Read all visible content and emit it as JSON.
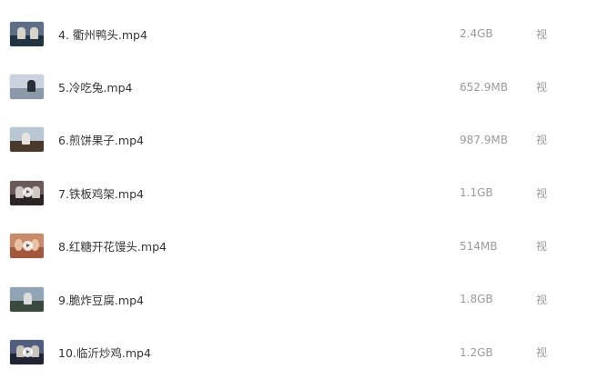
{
  "files": [
    {
      "name": "4. 衢州鸭头.mp4",
      "size": "2.4GB",
      "type": "视",
      "thumb_icon": "video-thumbnail",
      "thumb_colors": [
        "#5d6f86",
        "#223344",
        "#d9d2c8"
      ],
      "play_overlay": false
    },
    {
      "name": "5.冷吃兔.mp4",
      "size": "652.9MB",
      "type": "视",
      "thumb_icon": "video-thumbnail",
      "thumb_colors": [
        "#c9d2de",
        "#8a98aa",
        "#2a2f36"
      ],
      "play_overlay": false
    },
    {
      "name": "6.煎饼果子.mp4",
      "size": "987.9MB",
      "type": "视",
      "thumb_icon": "video-thumbnail",
      "thumb_colors": [
        "#b9c6d3",
        "#4a3a2c",
        "#e8e3dc"
      ],
      "play_overlay": false
    },
    {
      "name": "7.铁板鸡架.mp4",
      "size": "1.1GB",
      "type": "视",
      "thumb_icon": "video-thumbnail",
      "thumb_colors": [
        "#6b5a5a",
        "#2b2525",
        "#cfc7c2"
      ],
      "play_overlay": true
    },
    {
      "name": "8.红糖开花馒头.mp4",
      "size": "514MB",
      "type": "视",
      "thumb_icon": "video-thumbnail",
      "thumb_colors": [
        "#c98a6a",
        "#a2583c",
        "#e9c2a6"
      ],
      "play_overlay": true
    },
    {
      "name": "9.脆炸豆腐.mp4",
      "size": "1.8GB",
      "type": "视",
      "thumb_icon": "video-thumbnail",
      "thumb_colors": [
        "#8fa5b6",
        "#3b4a3e",
        "#dcdcdc"
      ],
      "play_overlay": false
    },
    {
      "name": "10.临沂炒鸡.mp4",
      "size": "1.2GB",
      "type": "视",
      "thumb_icon": "video-thumbnail",
      "thumb_colors": [
        "#4f5f7d",
        "#1f2533",
        "#c9c2bb"
      ],
      "play_overlay": true
    }
  ]
}
